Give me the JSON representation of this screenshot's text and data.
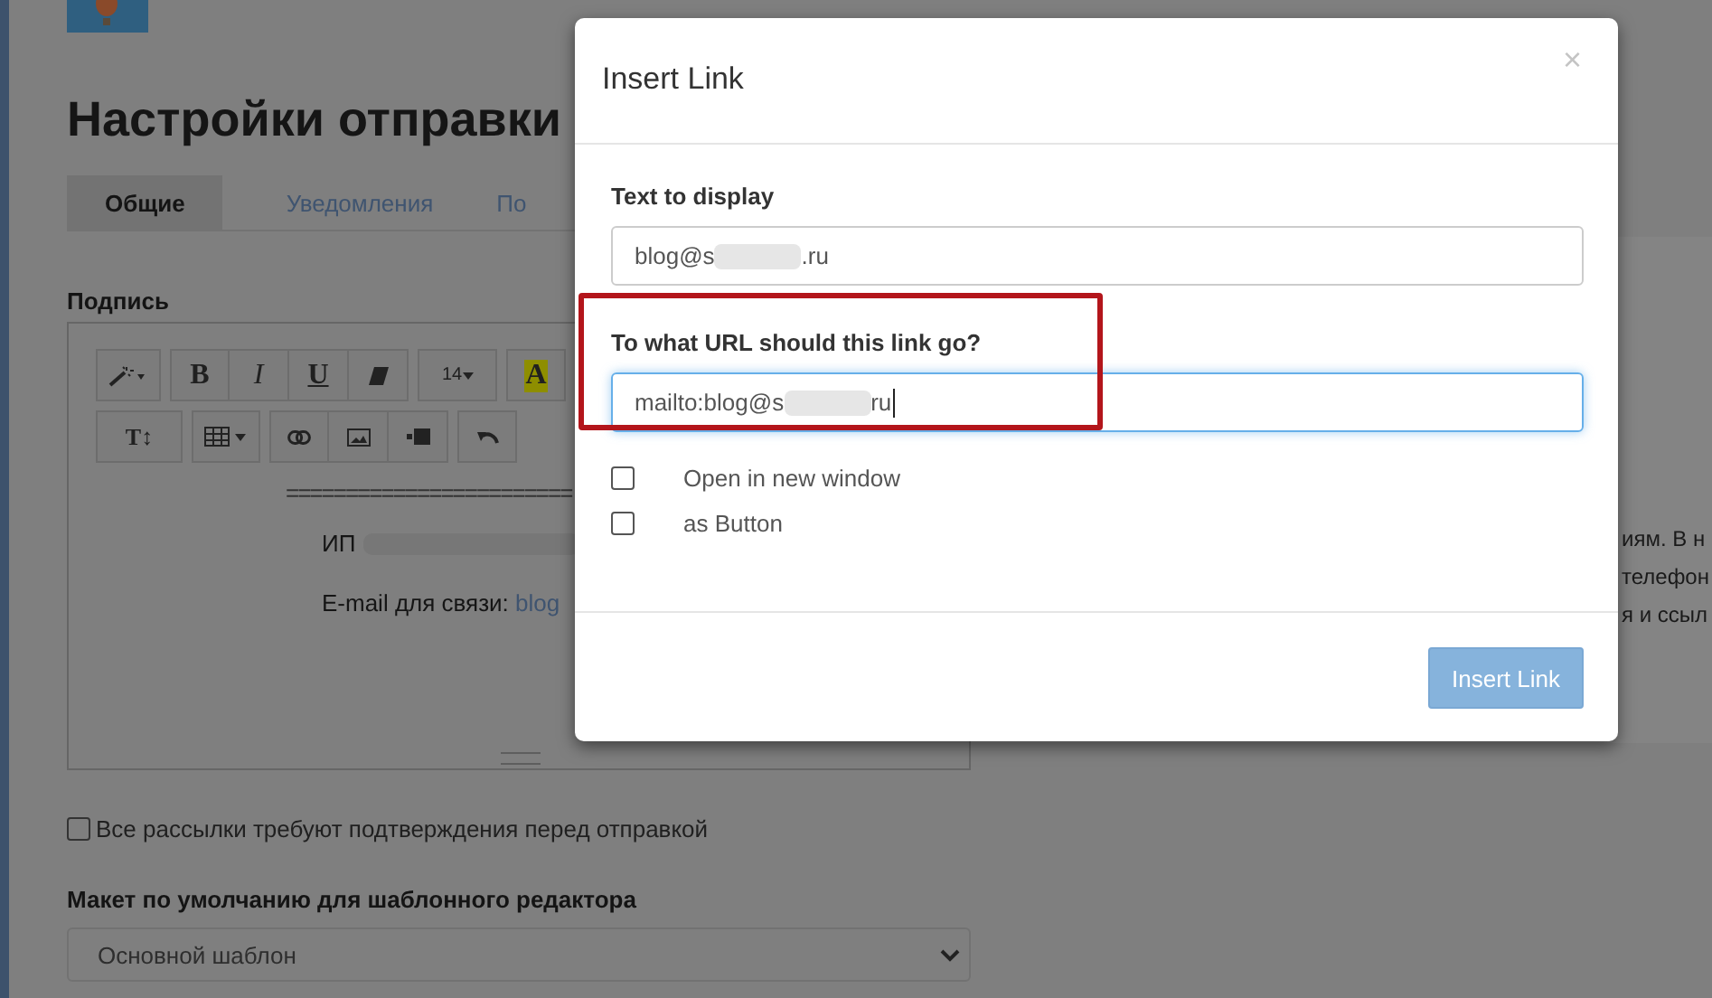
{
  "page": {
    "title": "Настройки отправки",
    "tabs": [
      {
        "label": "Общие",
        "selected": true
      },
      {
        "label": "Уведомления",
        "selected": false
      },
      {
        "label": "По",
        "selected": false
      }
    ],
    "signature_label": "Подпись",
    "toolbar": {
      "bold": "B",
      "italic": "I",
      "underline": "U",
      "font_size": "14",
      "highlight": "A",
      "style": "T↕"
    },
    "signature": {
      "separator": "========================",
      "line_1": "ИП",
      "line_2_label": "E-mail для связи:",
      "line_2_link": "blog"
    },
    "confirm_checkbox": {
      "label": "Все рассылки требуют подтверждения перед отправкой",
      "checked": false
    },
    "layout_label": "Макет по умолчанию для шаблонного редактора",
    "layout_select": {
      "value": "Основной шаблон"
    },
    "side_text": [
      "иям. В н",
      "телефон",
      "я и ссыл"
    ]
  },
  "dialog": {
    "title": "Insert Link",
    "close": "×",
    "text_label": "Text to display",
    "text_value_start": "blog@s",
    "text_value_end": ".ru",
    "url_label": "To what URL should this link go?",
    "url_value_start": "mailto:blog@s",
    "url_value_end": "ru",
    "url_highlighted": true,
    "options": [
      {
        "label": "Open in new window",
        "checked": false
      },
      {
        "label": "as Button",
        "checked": false
      }
    ],
    "button": "Insert Link"
  }
}
